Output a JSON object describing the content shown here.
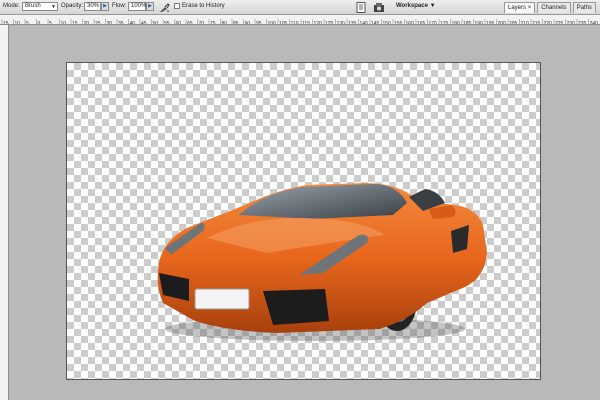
{
  "options_bar": {
    "mode_label": "Mode:",
    "mode_value": "Brush",
    "opacity_label": "Opacity:",
    "opacity_value": "30%",
    "flow_label": "Flow:",
    "flow_value": "100%",
    "erase_to_history_label": "Erase to History",
    "erase_to_history_checked": false,
    "workspace_label": "Workspace"
  },
  "panel_tabs": [
    {
      "label": "Layers",
      "active": true,
      "close": "×"
    },
    {
      "label": "Channels",
      "active": false
    },
    {
      "label": "Paths",
      "active": false
    }
  ],
  "ruler_labels": [
    "15",
    "10",
    "5",
    "0",
    "5",
    "10",
    "15",
    "20",
    "25",
    "30",
    "35",
    "40",
    "45",
    "50",
    "55",
    "60",
    "65",
    "70",
    "75",
    "80",
    "85",
    "90",
    "95",
    "100",
    "105",
    "110",
    "115",
    "120",
    "125",
    "130",
    "135",
    "140",
    "145",
    "150",
    "155",
    "160",
    "165",
    "170",
    "175",
    "180",
    "185",
    "190",
    "195",
    "200",
    "205",
    "210",
    "215",
    "220",
    "225",
    "230",
    "235",
    "240"
  ],
  "canvas_image": "orange sports car on transparent background",
  "colors": {
    "car_body": "#e8661c",
    "checker_light": "#ffffff",
    "checker_dark": "#cccccc",
    "app_bg": "#b9b9b9"
  },
  "icons": {
    "airbrush": "airbrush-icon",
    "document": "document-icon",
    "palette": "palette-icon"
  }
}
